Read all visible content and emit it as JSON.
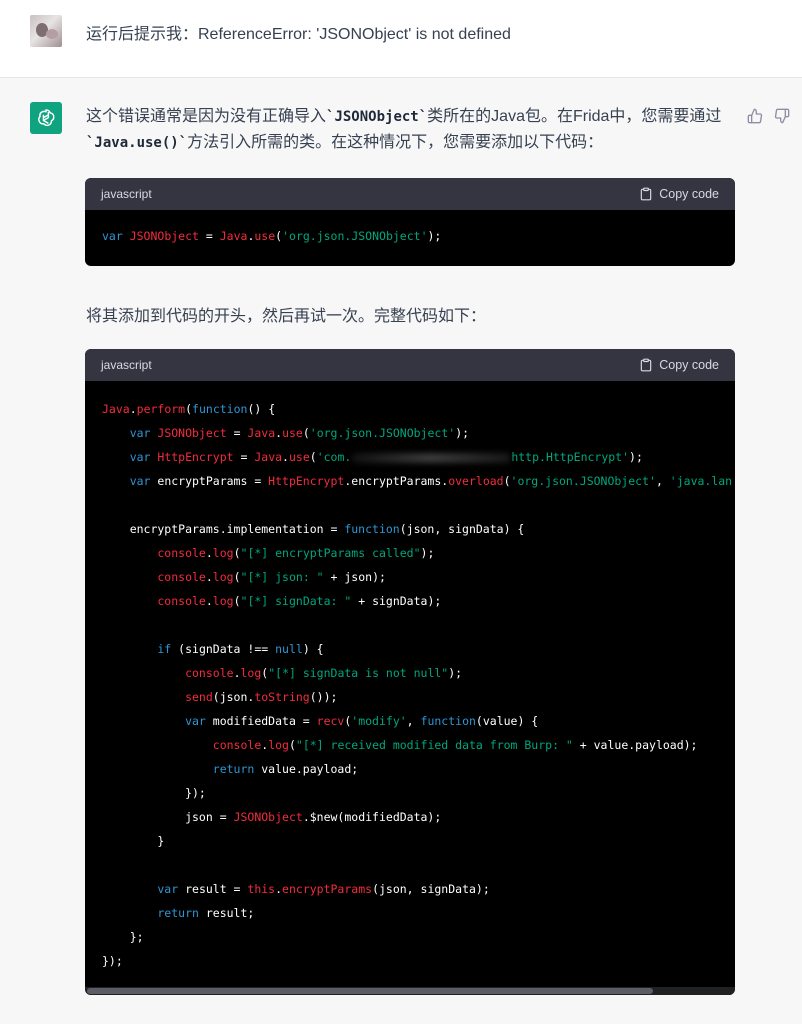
{
  "user_message": {
    "text": "运行后提示我：ReferenceError: 'JSONObject' is not defined"
  },
  "assistant": {
    "para1_a": "这个错误通常是因为没有正确导入",
    "para1_code1": "`JSONObject`",
    "para1_b": "类所在的Java包。在Frida中，您需要通过",
    "para1_code2": "`Java.use()`",
    "para1_c": "方法引入所需的类。在这种情况下，您需要添加以下代码：",
    "para2": "将其添加到代码的开头，然后再试一次。完整代码如下：",
    "icons": {
      "avatar": "openai-logo-icon",
      "thumbs_up": "thumbs-up-icon",
      "thumbs_down": "thumbs-down-icon",
      "copy": "clipboard-icon"
    },
    "colors": {
      "accent": "#10a37f",
      "code_bg": "#000000",
      "code_header": "#343541"
    }
  },
  "code1": {
    "language": "javascript",
    "copy_label": "Copy code",
    "l1": [
      {
        "t": "var ",
        "c": "kw"
      },
      {
        "t": "JSONObject",
        "c": "fn"
      },
      {
        "t": " = ",
        "c": "plain"
      },
      {
        "t": "Java",
        "c": "fn"
      },
      {
        "t": ".",
        "c": "plain"
      },
      {
        "t": "use",
        "c": "fn"
      },
      {
        "t": "(",
        "c": "plain"
      },
      {
        "t": "'org.json.JSONObject'",
        "c": "str"
      },
      {
        "t": ");",
        "c": "plain"
      }
    ]
  },
  "code2": {
    "language": "javascript",
    "copy_label": "Copy code",
    "lines": [
      [
        {
          "t": "Java",
          "c": "fn"
        },
        {
          "t": ".",
          "c": "plain"
        },
        {
          "t": "perform",
          "c": "fn"
        },
        {
          "t": "(",
          "c": "plain"
        },
        {
          "t": "function",
          "c": "kw"
        },
        {
          "t": "() {",
          "c": "plain"
        }
      ],
      [
        {
          "t": "    var ",
          "c": "kw"
        },
        {
          "t": "JSONObject",
          "c": "fn"
        },
        {
          "t": " = ",
          "c": "plain"
        },
        {
          "t": "Java",
          "c": "fn"
        },
        {
          "t": ".",
          "c": "plain"
        },
        {
          "t": "use",
          "c": "fn"
        },
        {
          "t": "(",
          "c": "plain"
        },
        {
          "t": "'org.json.JSONObject'",
          "c": "str"
        },
        {
          "t": ");",
          "c": "plain"
        }
      ],
      [
        {
          "t": "    var ",
          "c": "kw"
        },
        {
          "t": "HttpEncrypt",
          "c": "fn"
        },
        {
          "t": " = ",
          "c": "plain"
        },
        {
          "t": "Java",
          "c": "fn"
        },
        {
          "t": ".",
          "c": "plain"
        },
        {
          "t": "use",
          "c": "fn"
        },
        {
          "t": "(",
          "c": "plain"
        },
        {
          "t": "'com.",
          "c": "str"
        },
        {
          "t": "BLUR",
          "c": "blur"
        },
        {
          "t": "http.HttpEncrypt'",
          "c": "str"
        },
        {
          "t": ");",
          "c": "plain"
        }
      ],
      [
        {
          "t": "    var ",
          "c": "kw"
        },
        {
          "t": "encryptParams = ",
          "c": "plain"
        },
        {
          "t": "HttpEncrypt",
          "c": "fn"
        },
        {
          "t": ".encryptParams.",
          "c": "plain"
        },
        {
          "t": "overload",
          "c": "fn"
        },
        {
          "t": "(",
          "c": "plain"
        },
        {
          "t": "'org.json.JSONObject'",
          "c": "str"
        },
        {
          "t": ", ",
          "c": "plain"
        },
        {
          "t": "'java.lan",
          "c": "str"
        }
      ],
      [],
      [
        {
          "t": "    encryptParams.implementation = ",
          "c": "plain"
        },
        {
          "t": "function",
          "c": "kw"
        },
        {
          "t": "(json, signData) {",
          "c": "plain"
        }
      ],
      [
        {
          "t": "        console",
          "c": "fn"
        },
        {
          "t": ".",
          "c": "plain"
        },
        {
          "t": "log",
          "c": "fn"
        },
        {
          "t": "(",
          "c": "plain"
        },
        {
          "t": "\"[*] encryptParams called\"",
          "c": "str"
        },
        {
          "t": ");",
          "c": "plain"
        }
      ],
      [
        {
          "t": "        console",
          "c": "fn"
        },
        {
          "t": ".",
          "c": "plain"
        },
        {
          "t": "log",
          "c": "fn"
        },
        {
          "t": "(",
          "c": "plain"
        },
        {
          "t": "\"[*] json: \"",
          "c": "str"
        },
        {
          "t": " + json);",
          "c": "plain"
        }
      ],
      [
        {
          "t": "        console",
          "c": "fn"
        },
        {
          "t": ".",
          "c": "plain"
        },
        {
          "t": "log",
          "c": "fn"
        },
        {
          "t": "(",
          "c": "plain"
        },
        {
          "t": "\"[*] signData: \"",
          "c": "str"
        },
        {
          "t": " + signData);",
          "c": "plain"
        }
      ],
      [],
      [
        {
          "t": "        if ",
          "c": "kw"
        },
        {
          "t": "(signData !== ",
          "c": "plain"
        },
        {
          "t": "null",
          "c": "kw"
        },
        {
          "t": ") {",
          "c": "plain"
        }
      ],
      [
        {
          "t": "            console",
          "c": "fn"
        },
        {
          "t": ".",
          "c": "plain"
        },
        {
          "t": "log",
          "c": "fn"
        },
        {
          "t": "(",
          "c": "plain"
        },
        {
          "t": "\"[*] signData is not null\"",
          "c": "str"
        },
        {
          "t": ");",
          "c": "plain"
        }
      ],
      [
        {
          "t": "            send",
          "c": "fn"
        },
        {
          "t": "(json.",
          "c": "plain"
        },
        {
          "t": "toString",
          "c": "fn"
        },
        {
          "t": "());",
          "c": "plain"
        }
      ],
      [
        {
          "t": "            var ",
          "c": "kw"
        },
        {
          "t": "modifiedData = ",
          "c": "plain"
        },
        {
          "t": "recv",
          "c": "fn"
        },
        {
          "t": "(",
          "c": "plain"
        },
        {
          "t": "'modify'",
          "c": "str"
        },
        {
          "t": ", ",
          "c": "plain"
        },
        {
          "t": "function",
          "c": "kw"
        },
        {
          "t": "(value) {",
          "c": "plain"
        }
      ],
      [
        {
          "t": "                console",
          "c": "fn"
        },
        {
          "t": ".",
          "c": "plain"
        },
        {
          "t": "log",
          "c": "fn"
        },
        {
          "t": "(",
          "c": "plain"
        },
        {
          "t": "\"[*] received modified data from Burp: \"",
          "c": "str"
        },
        {
          "t": " + value.payload);",
          "c": "plain"
        }
      ],
      [
        {
          "t": "                return ",
          "c": "kw"
        },
        {
          "t": "value.payload;",
          "c": "plain"
        }
      ],
      [
        {
          "t": "            });",
          "c": "plain"
        }
      ],
      [
        {
          "t": "            json = ",
          "c": "plain"
        },
        {
          "t": "JSONObject",
          "c": "fn"
        },
        {
          "t": ".$new(modifiedData);",
          "c": "plain"
        }
      ],
      [
        {
          "t": "        }",
          "c": "plain"
        }
      ],
      [],
      [
        {
          "t": "        var ",
          "c": "kw"
        },
        {
          "t": "result = ",
          "c": "plain"
        },
        {
          "t": "this",
          "c": "fn"
        },
        {
          "t": ".",
          "c": "plain"
        },
        {
          "t": "encryptParams",
          "c": "fn"
        },
        {
          "t": "(json, signData);",
          "c": "plain"
        }
      ],
      [
        {
          "t": "        return ",
          "c": "kw"
        },
        {
          "t": "result;",
          "c": "plain"
        }
      ],
      [
        {
          "t": "    };",
          "c": "plain"
        }
      ],
      [
        {
          "t": "});",
          "c": "plain"
        }
      ]
    ]
  }
}
